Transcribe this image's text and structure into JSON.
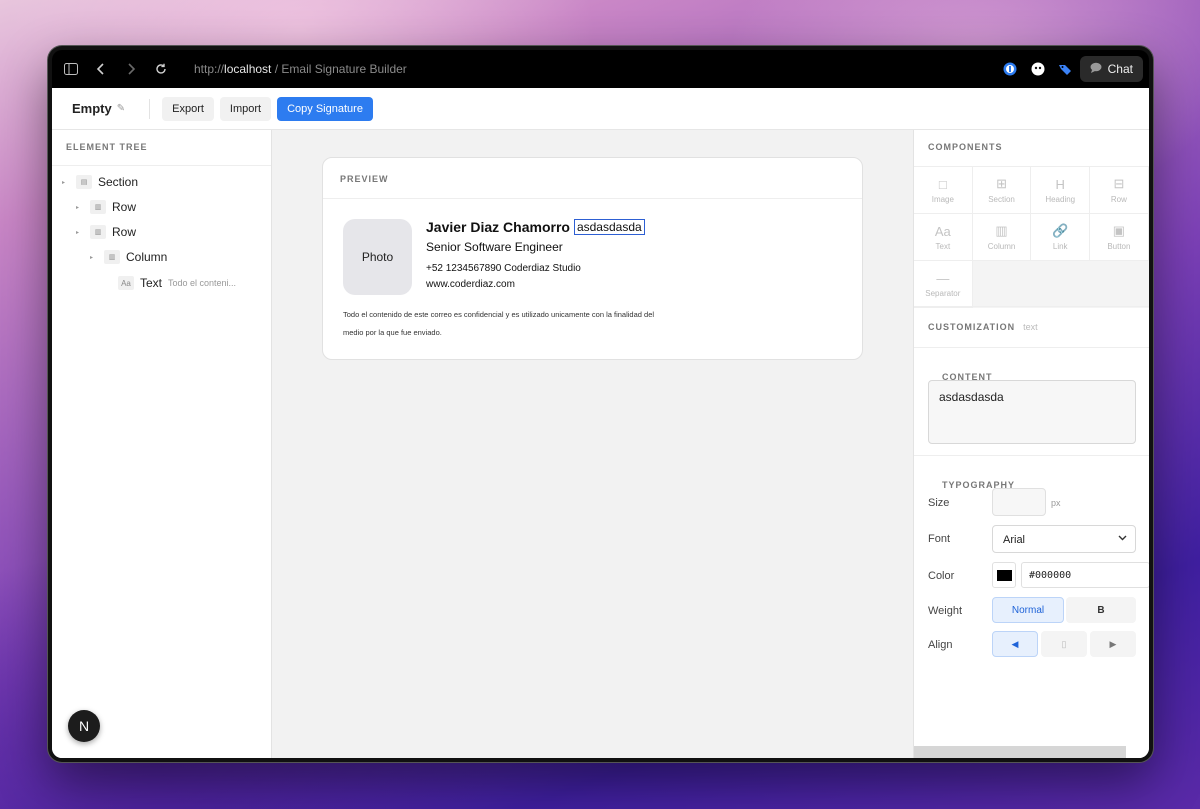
{
  "browser": {
    "url_prefix": "http://",
    "url_host": "localhost",
    "url_rest": " / Email Signature Builder",
    "chat_label": "Chat"
  },
  "toolbar": {
    "doc_title": "Empty",
    "export_label": "Export",
    "import_label": "Import",
    "copy_label": "Copy Signature"
  },
  "tree": {
    "header": "ELEMENT TREE",
    "nodes": [
      {
        "label": "Section",
        "icon": "▤"
      },
      {
        "label": "Row",
        "icon": "▥"
      },
      {
        "label": "Row",
        "icon": "▥"
      },
      {
        "label": "Column",
        "icon": "▥"
      },
      {
        "label": "Text",
        "icon": "Aa",
        "hint": "Todo el conteni..."
      }
    ]
  },
  "preview": {
    "header": "PREVIEW",
    "photo_label": "Photo",
    "name": "Javier Diaz Chamorro",
    "selected_text": "asdasdasda",
    "role": "Senior Software Engineer",
    "contact": "+52 1234567890 Coderdiaz Studio",
    "website": "www.coderdiaz.com",
    "disclaimer": "Todo el contenido de este correo es confidencial y es utilizado unicamente con la finalidad del medio por la que fue enviado."
  },
  "components": {
    "header": "COMPONENTS",
    "items": [
      {
        "label": "Image",
        "icon": "□"
      },
      {
        "label": "Section",
        "icon": "⊞"
      },
      {
        "label": "Heading",
        "icon": "H"
      },
      {
        "label": "Row",
        "icon": "⊟"
      },
      {
        "label": "Text",
        "icon": "Aa"
      },
      {
        "label": "Column",
        "icon": "▥"
      },
      {
        "label": "Link",
        "icon": "🔗"
      },
      {
        "label": "Button",
        "icon": "▣"
      },
      {
        "label": "Separator",
        "icon": "—"
      }
    ]
  },
  "customization": {
    "header": "CUSTOMIZATION",
    "type": "text",
    "content_header": "CONTENT",
    "content_value": "asdasdasda",
    "typography_header": "TYPOGRAPHY",
    "size_label": "Size",
    "size_value": "",
    "size_unit": "px",
    "font_label": "Font",
    "font_value": "Arial",
    "color_label": "Color",
    "color_value": "#000000",
    "weight_label": "Weight",
    "weight_options": [
      "Normal",
      "B"
    ],
    "weight_selected": "Normal",
    "align_label": "Align",
    "align_options": [
      "◀",
      "▯",
      "▶"
    ],
    "align_selected": "left"
  },
  "colors": {
    "accent": "#2d7cf0",
    "selection_border": "#2d5fd3"
  }
}
